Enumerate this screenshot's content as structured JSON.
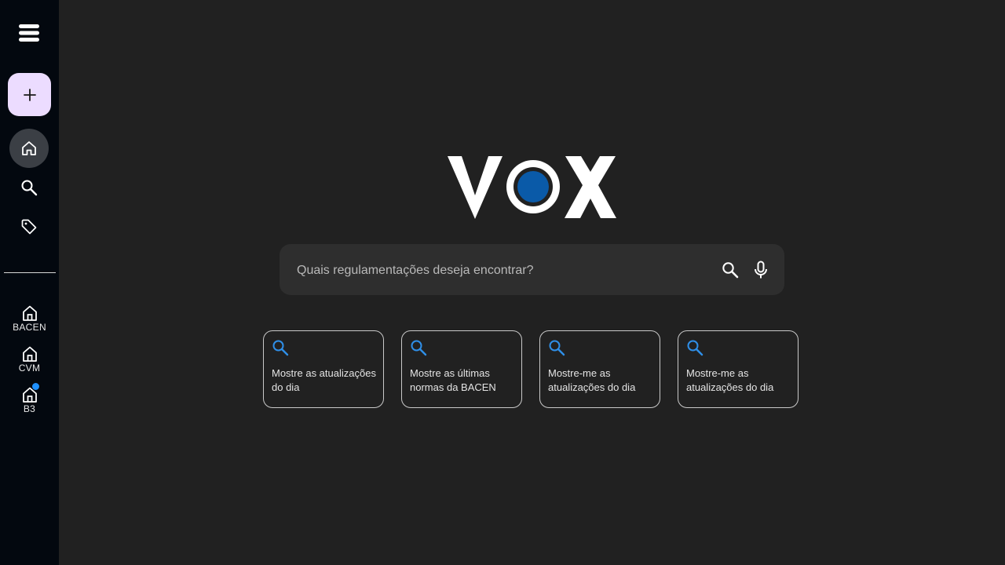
{
  "app": {
    "logo_text": "VOX",
    "logo_accent": "#0a5aa8"
  },
  "sidebar": {
    "menu_icon": "menu-icon",
    "new_button_icon": "plus-icon",
    "nav": [
      {
        "name": "home",
        "icon": "home-icon",
        "active": true
      },
      {
        "name": "search",
        "icon": "search-icon"
      },
      {
        "name": "tags",
        "icon": "tag-icon"
      }
    ],
    "orgs": [
      {
        "label": "BACEN",
        "icon": "institution-icon"
      },
      {
        "label": "CVM",
        "icon": "institution-icon"
      },
      {
        "label": "B3",
        "icon": "institution-icon",
        "has_notification": true
      }
    ]
  },
  "search": {
    "placeholder": "Quais regulamentações deseja encontrar?",
    "value": ""
  },
  "suggestions": [
    {
      "text": "Mostre as atualizações do dia"
    },
    {
      "text": "Mostre as últimas normas da BACEN"
    },
    {
      "text": "Mostre-me as atualizações do dia"
    },
    {
      "text": "Mostre-me as atualizações do dia"
    }
  ],
  "colors": {
    "background": "#212121",
    "sidebar": "#03080f",
    "new_button": "#ecdcff",
    "accent_blue": "#2f8fe8",
    "notification": "#1e90ff"
  }
}
